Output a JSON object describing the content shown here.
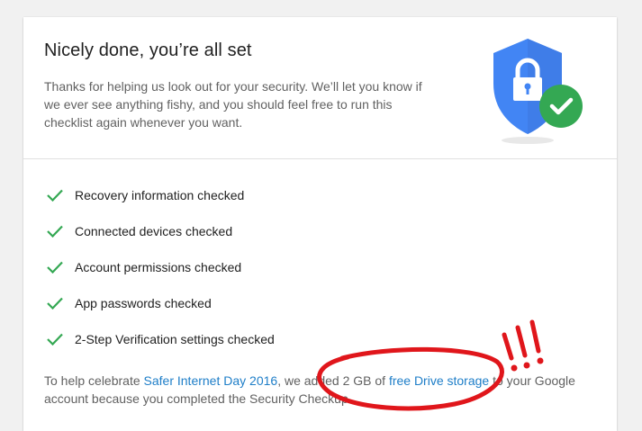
{
  "card": {
    "title": "Nicely done, you’re all set",
    "description": "Thanks for helping us look out for your security. We’ll let you know if we ever see anything fishy, and you should feel free to run this checklist again whenever you want.",
    "illustration_icons": [
      "shield-icon",
      "lock-icon",
      "check-badge-icon"
    ]
  },
  "checklist": [
    {
      "label": "Recovery information checked",
      "icon": "check-icon"
    },
    {
      "label": "Connected devices checked",
      "icon": "check-icon"
    },
    {
      "label": "Account permissions checked",
      "icon": "check-icon"
    },
    {
      "label": "App passwords checked",
      "icon": "check-icon"
    },
    {
      "label": "2-Step Verification settings checked",
      "icon": "check-icon"
    }
  ],
  "footer": {
    "text_1": "To help celebrate ",
    "link_1": "Safer Internet Day 2016",
    "text_2": ", we added 2 GB of ",
    "link_2": "free Drive storage",
    "text_3": " to your Google account because you completed the Security Checkup."
  },
  "annotation": {
    "text": "!!!"
  },
  "colors": {
    "shield_blue": "#4285f4",
    "check_green": "#34a853",
    "link_blue": "#1e7ec8",
    "annotation_red": "#e0161b"
  }
}
